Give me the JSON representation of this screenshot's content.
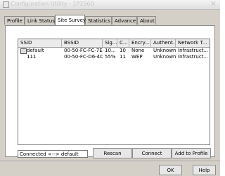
{
  "window": {
    "title": "Configuration Utility - 1P2560",
    "close_symbol": "✕"
  },
  "tabs": [
    {
      "label": "Profile"
    },
    {
      "label": "Link Status"
    },
    {
      "label": "Site Survey",
      "active": true
    },
    {
      "label": "Statistics"
    },
    {
      "label": "Advance"
    },
    {
      "label": "About"
    }
  ],
  "table": {
    "columns": [
      "SSID",
      "BSSID",
      "Sig...",
      "C...",
      "Encry...",
      "Authent...",
      "Network T..."
    ],
    "rows": [
      {
        "ssid": "default",
        "bssid": "00-50-FC-FC-7E-...",
        "signal": "10...",
        "channel": "10",
        "encryption": "None",
        "auth": "Unknown",
        "network": "Infrastruct...",
        "connected": true
      },
      {
        "ssid": "111",
        "bssid": "00-50-FC-D6-4C...",
        "signal": "55%",
        "channel": "11",
        "encryption": "WEP",
        "auth": "Unknown",
        "network": "Infrastruct...",
        "connected": false
      }
    ]
  },
  "status": "Connected <--> default",
  "buttons": {
    "rescan": "Rescan",
    "connect": "Connect",
    "add_profile": "Add to Profile",
    "ok": "OK",
    "help": "Help"
  },
  "icons": {
    "title": "app-icon",
    "row": "connected-station-icon"
  }
}
